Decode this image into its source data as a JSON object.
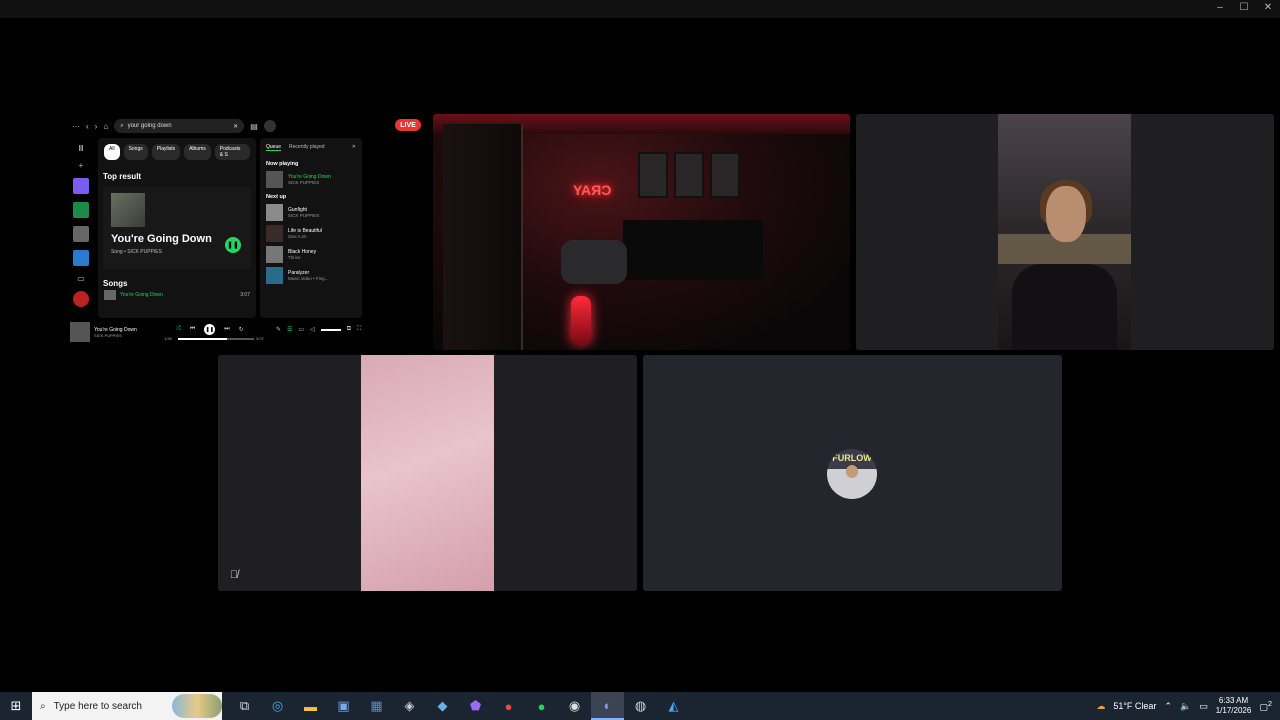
{
  "window": {
    "minimize": "–",
    "maximize": "☐",
    "close": "✕"
  },
  "spotify": {
    "menu": "···",
    "search_value": "your going down",
    "filters": [
      "All",
      "Songs",
      "Playlists",
      "Albums",
      "Podcasts & S"
    ],
    "top_result_heading": "Top result",
    "top_result": {
      "title": "You're Going Down",
      "type": "Song",
      "artist": "SICK PUPPIES"
    },
    "songs_heading": "Songs",
    "songs": [
      {
        "title": "You're Going Down",
        "duration": "3:07"
      }
    ],
    "queue_tabs": [
      "Queue",
      "Recently played"
    ],
    "now_playing_heading": "Now playing",
    "now_playing": {
      "title": "You're Going Down",
      "artist": "SICK PUPPIES"
    },
    "next_up_heading": "Next up",
    "next_up": [
      {
        "title": "Gunfight",
        "artist": "SICK PUPPIES"
      },
      {
        "title": "Life is Beautiful",
        "artist": "Sixx:A.M."
      },
      {
        "title": "Black Honey",
        "artist": "Thrice"
      },
      {
        "title": "Paralyzer",
        "artist": "Music video • Fing..."
      }
    ],
    "player": {
      "title": "You're Going Down",
      "artist": "SICK PUPPIES",
      "elapsed": "1:59",
      "total": "3:07",
      "progress": 0.64
    }
  },
  "live_badge": "LIVE",
  "room_stream": {
    "neon_sign": "CRAY"
  },
  "avatar_tile": {
    "avatar_text": "FURLOW"
  },
  "taskbar": {
    "search_placeholder": "Type here to search",
    "weather": "51°F  Clear",
    "time": "6:33 AM",
    "date": "1/17/2026",
    "notifications": "2"
  }
}
